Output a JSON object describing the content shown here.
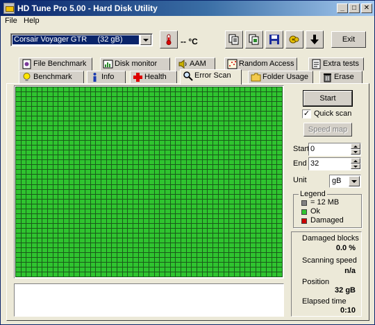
{
  "window": {
    "title": "HD Tune Pro 5.00 - Hard Disk Utility",
    "minimize_glyph": "_",
    "maximize_glyph": "□",
    "close_glyph": "✕"
  },
  "menu": {
    "file": "File",
    "help": "Help"
  },
  "toolbar": {
    "drive_name": "Corsair Voyager GTR",
    "drive_size": "(32 gB)",
    "temperature": "-- °C",
    "exit_label": "Exit",
    "icons": [
      "thermometer-icon",
      "copy-text-icon",
      "copy-image-icon",
      "save-icon",
      "options-icon",
      "download-icon"
    ]
  },
  "tabs": {
    "row1": [
      {
        "label": "File Benchmark",
        "icon": "file-benchmark-icon"
      },
      {
        "label": "Disk monitor",
        "icon": "disk-monitor-icon"
      },
      {
        "label": "AAM",
        "icon": "speaker-icon"
      },
      {
        "label": "Random Access",
        "icon": "random-access-icon"
      },
      {
        "label": "Extra tests",
        "icon": "extra-tests-icon"
      }
    ],
    "row2": [
      {
        "label": "Benchmark",
        "icon": "lightbulb-icon"
      },
      {
        "label": "Info",
        "icon": "info-icon"
      },
      {
        "label": "Health",
        "icon": "health-cross-icon"
      },
      {
        "label": "Error Scan",
        "icon": "magnifier-icon",
        "active": true
      },
      {
        "label": "Folder Usage",
        "icon": "folder-icon"
      },
      {
        "label": "Erase",
        "icon": "trash-icon"
      }
    ]
  },
  "scan": {
    "grid_rows": 39,
    "grid_cols": 50,
    "block_status": "ok",
    "colors": {
      "ok": "#2fc42f",
      "damaged": "#cc0000",
      "unscanned": "#808080",
      "grid_line": "#1a5a1a"
    },
    "start_button": "Start",
    "quick_scan_label": "Quick scan",
    "quick_scan_checked": true,
    "speed_map_button": "Speed map",
    "start_label": "Start",
    "start_value": "0",
    "end_label": "End",
    "end_value": "32",
    "unit_label": "Unit",
    "unit_value": "gB"
  },
  "legend": {
    "title": "Legend",
    "items": [
      {
        "label": "= 12 MB",
        "color": "#808080"
      },
      {
        "label": "Ok",
        "color": "#2fc42f"
      },
      {
        "label": "Damaged",
        "color": "#cc0000"
      }
    ]
  },
  "stats": {
    "damaged_blocks_label": "Damaged blocks",
    "damaged_blocks_value": "0.0 %",
    "scanning_speed_label": "Scanning speed",
    "scanning_speed_value": "n/a",
    "position_label": "Position",
    "position_value": "32 gB",
    "elapsed_label": "Elapsed time",
    "elapsed_value": "0:10"
  },
  "log": {
    "text": ""
  }
}
